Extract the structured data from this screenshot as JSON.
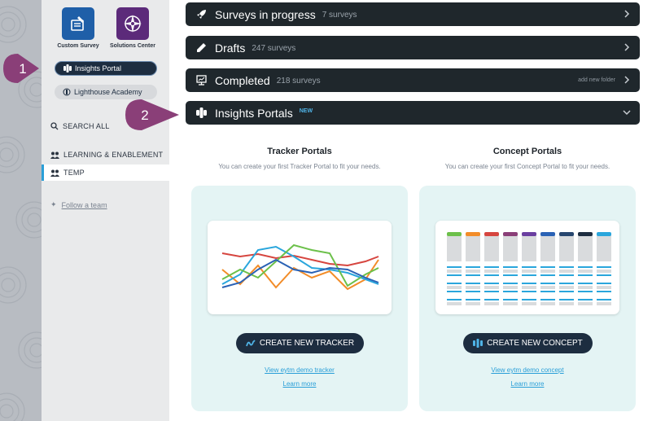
{
  "sidebar": {
    "apps": [
      {
        "label": "Custom Survey",
        "icon": "pencil-document-icon"
      },
      {
        "label": "Solutions Center",
        "icon": "compass-star-icon"
      }
    ],
    "insights_portal": "Insights Portal",
    "lighthouse_academy": "Lighthouse Academy",
    "search_all": "SEARCH ALL",
    "teams": [
      "LEARNING & ENABLEMENT",
      "TEMP"
    ],
    "follow_team": "Follow a team"
  },
  "callouts": [
    "1",
    "2"
  ],
  "rows": [
    {
      "title": "Surveys in progress",
      "count": "7 surveys",
      "icon": "rocket-icon"
    },
    {
      "title": "Drafts",
      "count": "247 surveys",
      "icon": "pencil-icon"
    },
    {
      "title": "Completed",
      "count": "218 surveys",
      "extra": "add new folder",
      "icon": "monitor-chart-icon"
    },
    {
      "title": "Insights Portals",
      "badge": "NEW",
      "icon": "insights-portal-icon"
    }
  ],
  "tracker": {
    "heading": "Tracker Portals",
    "subtitle": "You can create your first Tracker Portal to fit your needs.",
    "cta": "CREATE NEW TRACKER",
    "demo_link": "View eytm demo tracker",
    "learn_more": "Learn more"
  },
  "concept": {
    "heading": "Concept Portals",
    "subtitle": "You can create your first Concept Portal to fit your needs.",
    "cta": "CREATE NEW CONCEPT",
    "demo_link": "View eytm demo concept",
    "learn_more": "Learn more"
  },
  "colors": {
    "row_bg": "#1f272c",
    "cta_bg": "#1d2d40",
    "accent": "#2a9fd8",
    "callout": "#8a3f78",
    "card_bg": "#e4f4f4"
  }
}
